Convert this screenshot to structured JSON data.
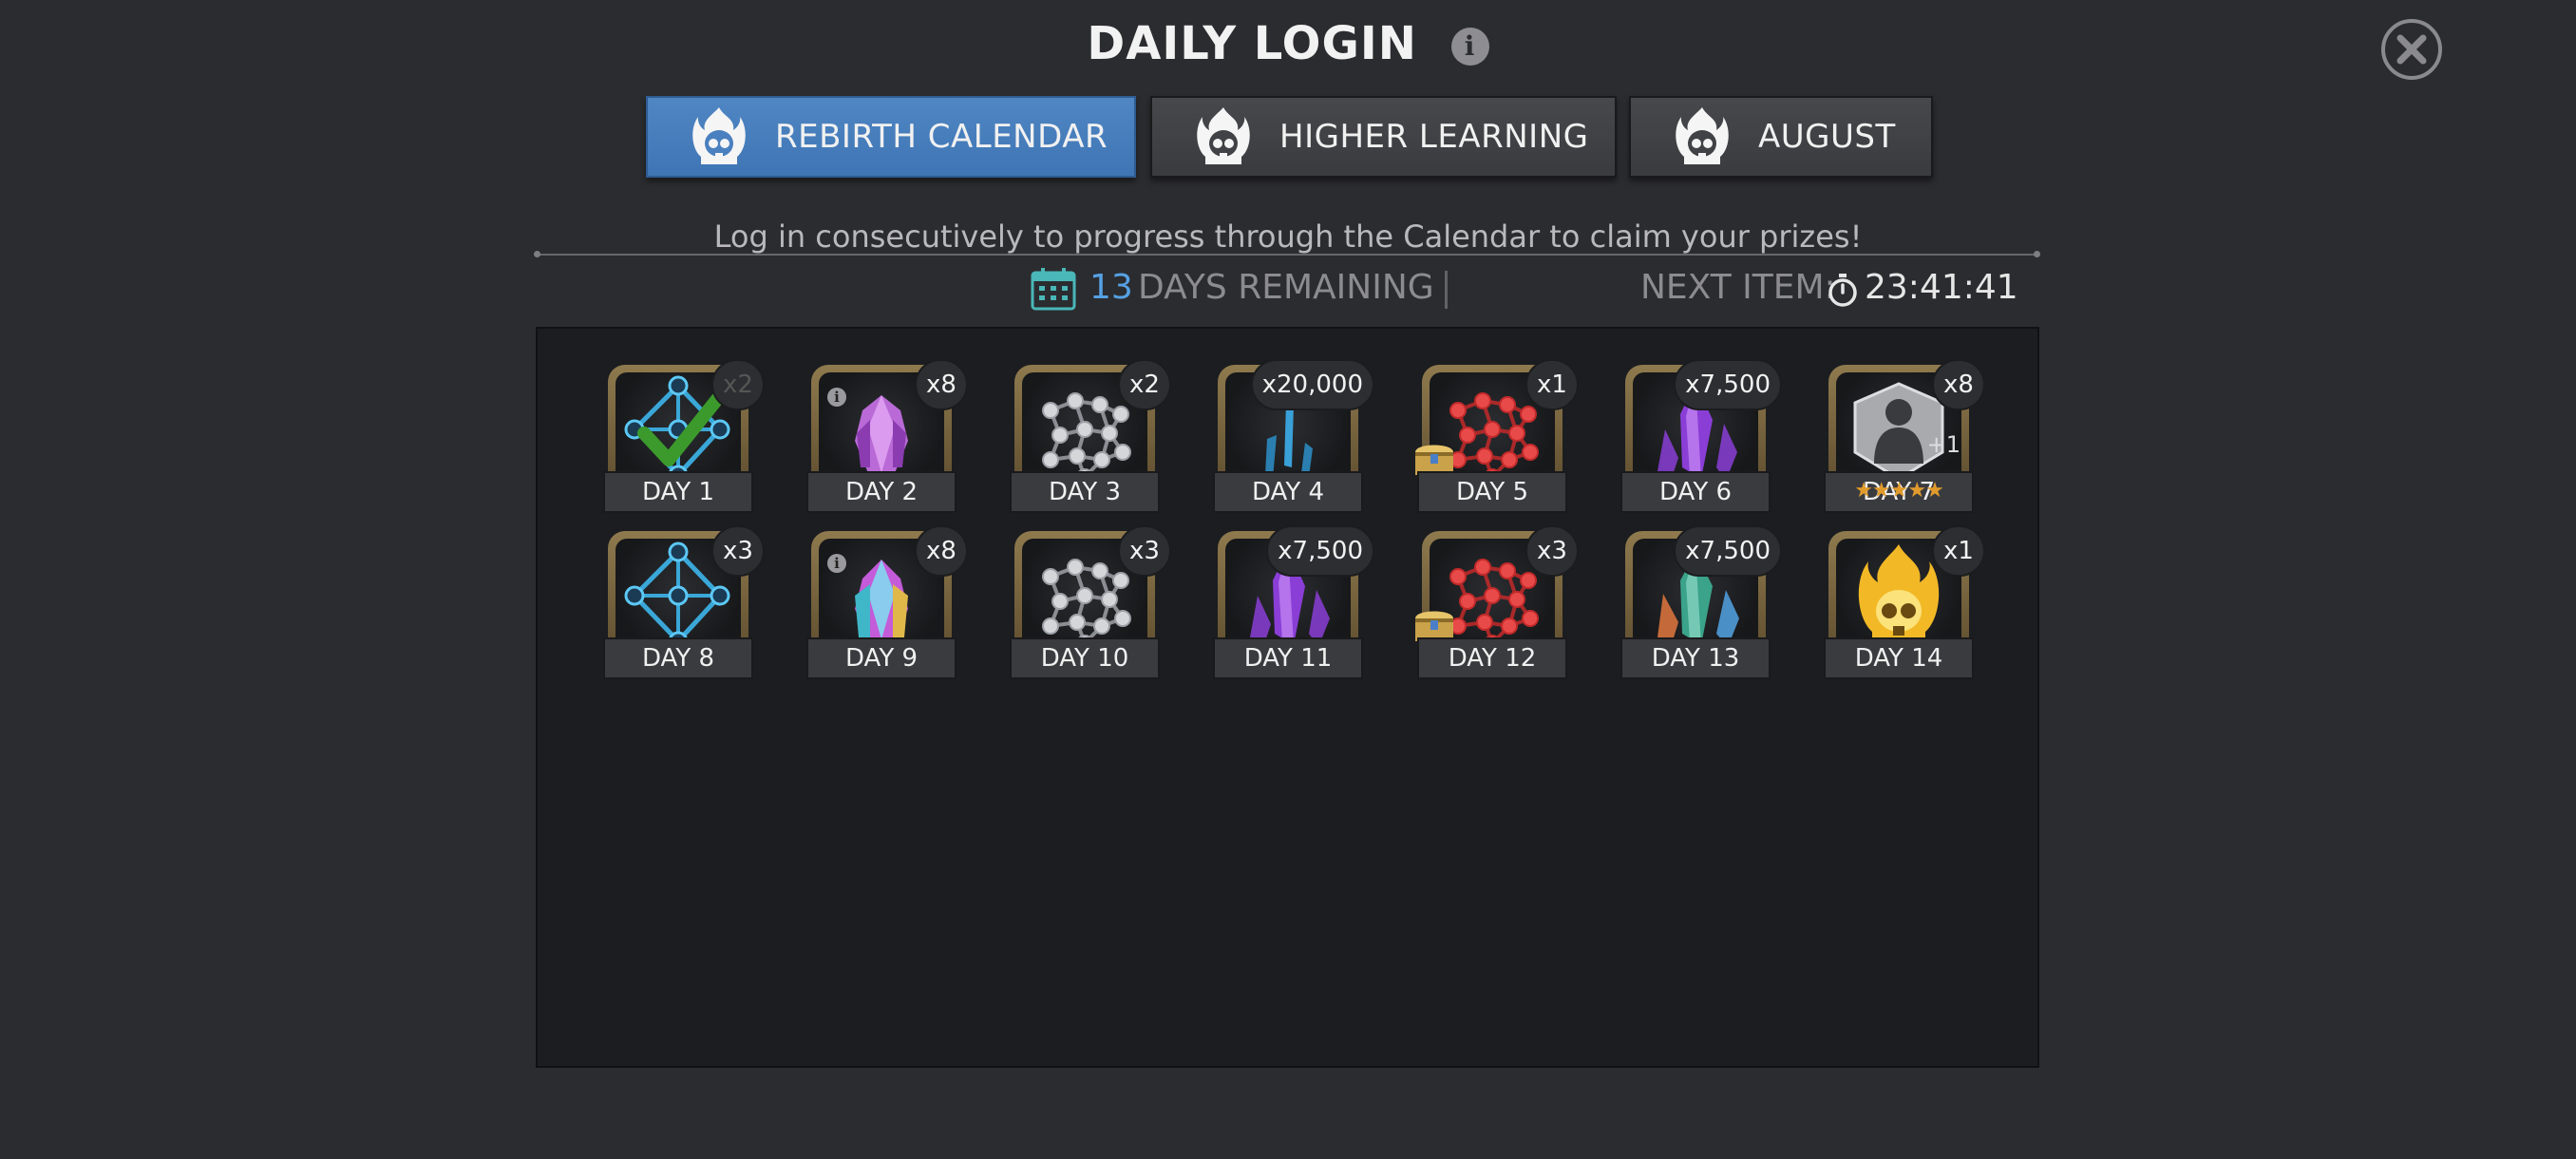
{
  "header": {
    "title": "DAILY LOGIN",
    "info_icon": "i",
    "close_icon": "close-icon"
  },
  "tabs": [
    {
      "label": "REBIRTH CALENDAR",
      "active": true,
      "icon": "flame-skull-icon"
    },
    {
      "label": "HIGHER LEARNING",
      "active": false,
      "icon": "flame-skull-icon"
    },
    {
      "label": "AUGUST",
      "active": false,
      "icon": "flame-skull-icon"
    }
  ],
  "description": "Log in consecutively to progress through the Calendar to claim your prizes!",
  "status": {
    "days_remaining_count": "13",
    "days_remaining_label": "DAYS REMAINING",
    "next_item_label": "NEXT ITEM:",
    "next_item_time": "23:41:41"
  },
  "colors": {
    "active_tab": "#4a80bf",
    "accent_count": "#56a1e4",
    "claimed_check": "#3c9a2c"
  },
  "days": [
    {
      "label": "DAY 1",
      "qty": "x2",
      "item": "blue-catalyst-network",
      "claimed": true
    },
    {
      "label": "DAY 2",
      "qty": "x8",
      "item": "purple-crystal",
      "info": "i"
    },
    {
      "label": "DAY 3",
      "qty": "x2",
      "item": "silver-catalyst-network"
    },
    {
      "label": "DAY 4",
      "qty": "x20,000",
      "item": "blue-energy-shards"
    },
    {
      "label": "DAY 5",
      "qty": "x1",
      "item": "red-catalyst-network",
      "chest": true
    },
    {
      "label": "DAY 6",
      "qty": "x7,500",
      "item": "purple-shards"
    },
    {
      "label": "DAY 7",
      "qty": "x8",
      "item": "mystery-champion",
      "plus": "+1",
      "stars": "★★★★★"
    },
    {
      "label": "DAY 8",
      "qty": "x3",
      "item": "blue-catalyst-network"
    },
    {
      "label": "DAY 9",
      "qty": "x8",
      "item": "rainbow-crystal",
      "info": "i"
    },
    {
      "label": "DAY 10",
      "qty": "x3",
      "item": "silver-catalyst-network"
    },
    {
      "label": "DAY 11",
      "qty": "x7,500",
      "item": "purple-shards"
    },
    {
      "label": "DAY 12",
      "qty": "x3",
      "item": "red-catalyst-network",
      "chest": true
    },
    {
      "label": "DAY 13",
      "qty": "x7,500",
      "item": "teal-shards"
    },
    {
      "label": "DAY 14",
      "qty": "x1",
      "item": "golden-flame-skull"
    }
  ]
}
